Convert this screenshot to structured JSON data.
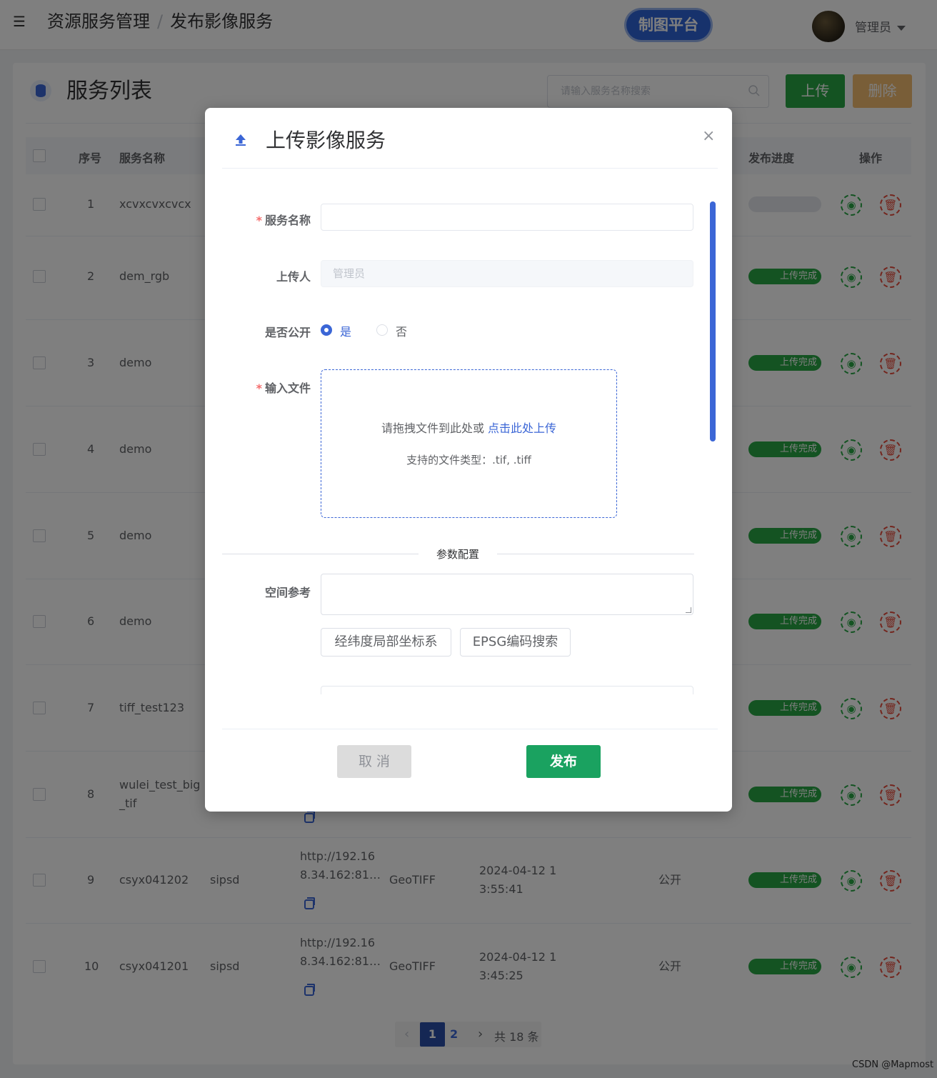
{
  "header": {
    "breadcrumb": [
      "资源服务管理",
      "发布影像服务"
    ],
    "breadcrumb_sep": "/",
    "platform_button": "制图平台",
    "user_name": "管理员"
  },
  "panel": {
    "title": "服务列表",
    "search_placeholder": "请输入服务名称搜索",
    "upload_label": "上传",
    "delete_label": "删除"
  },
  "table": {
    "headers": {
      "index": "序号",
      "name": "服务名称",
      "progress": "发布进度",
      "actions": "操作"
    },
    "rows": [
      {
        "index": "1",
        "name": "xcvxcvxcvcx",
        "progress_label": ""
      },
      {
        "index": "2",
        "name": "dem_rgb",
        "progress_label": "上传完成"
      },
      {
        "index": "3",
        "name": "demo",
        "progress_label": "上传完成"
      },
      {
        "index": "4",
        "name": "demo",
        "progress_label": "上传完成"
      },
      {
        "index": "5",
        "name": "demo",
        "progress_label": "上传完成"
      },
      {
        "index": "6",
        "name": "demo",
        "progress_label": "上传完成"
      },
      {
        "index": "7",
        "name": "tiff_test123",
        "progress_label": "上传完成"
      },
      {
        "index": "8",
        "name_line1": "wulei_test_big",
        "name_line2": "_tif",
        "progress_label": "上传完成"
      },
      {
        "index": "9",
        "name": "csyx041202",
        "source": "sipsd",
        "url_line1": "http://192.16",
        "url_line2": "8.34.162:81…",
        "type": "GeoTIFF",
        "time_line1": "2024-04-12 1",
        "time_line2": "3:55:41",
        "visibility": "公开",
        "progress_label": "上传完成"
      },
      {
        "index": "10",
        "name": "csyx041201",
        "source": "sipsd",
        "url_line1": "http://192.16",
        "url_line2": "8.34.162:81…",
        "type": "GeoTIFF",
        "time_line1": "2024-04-12 1",
        "time_line2": "3:45:25",
        "visibility": "公开",
        "progress_label": "上传完成"
      }
    ]
  },
  "pagination": {
    "prev": "‹",
    "page1": "1",
    "page2": "2",
    "next": "›",
    "total": "共 18 条"
  },
  "dialog": {
    "title": "上传影像服务",
    "close": "×",
    "fields": {
      "service_name_label": "服务名称",
      "uploader_label": "上传人",
      "uploader_value": "管理员",
      "public_label": "是否公开",
      "public_yes": "是",
      "public_no": "否",
      "public_selected": "是",
      "file_label": "输入文件",
      "required_mark": "*"
    },
    "dropzone": {
      "text": "请拖拽文件到此处或 ",
      "link": "点击此处上传",
      "hint": "支持的文件类型：.tif, .tiff"
    },
    "params_title": "参数配置",
    "spatial_ref_label": "空间参考",
    "latlon_button": "经纬度局部坐标系",
    "epsg_button": "EPSG编码搜索",
    "cancel_label": "取 消",
    "publish_label": "发布"
  },
  "watermark": "CSDN @Mapmost",
  "colors": {
    "primary": "#3b66d6",
    "success": "#28a745",
    "danger": "#e74c3c",
    "warning": "#f0ad4e"
  }
}
